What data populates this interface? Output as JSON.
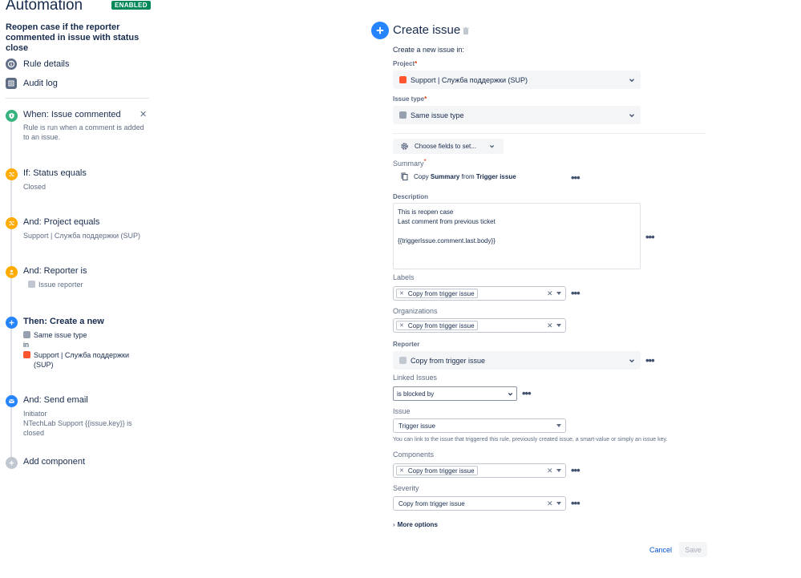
{
  "header": {
    "title": "Automation",
    "badge": "ENABLED"
  },
  "rule": {
    "name": "Reopen case if the reporter commented in issue with status close"
  },
  "nav": [
    {
      "label": "Rule details",
      "icon": "info-icon"
    },
    {
      "label": "Audit log",
      "icon": "log-icon"
    }
  ],
  "steps": {
    "trigger": {
      "title": "When: Issue commented",
      "sub": "Rule is run when a comment is added to an issue.",
      "color": "#36b37e"
    },
    "cond1": {
      "title": "If: Status equals",
      "sub": "Closed",
      "color": "#ffab00"
    },
    "cond2": {
      "title": "And: Project equals",
      "sub": "Support | Служба поддержки (SUP)",
      "color": "#ffab00"
    },
    "cond3": {
      "title": "And: Reporter is",
      "sub": "Issue reporter",
      "color": "#ffab00"
    },
    "action1": {
      "title": "Then: Create a new",
      "type": "Same issue type",
      "in": "in",
      "project": "Support | Служба поддержки (SUP)",
      "color": "#2684ff"
    },
    "action2": {
      "title": "And: Send email",
      "line1": "Initiator",
      "line2": "NTechLab Support {{issue.key}} is closed",
      "color": "#2684ff"
    },
    "add": {
      "title": "Add component"
    }
  },
  "editor": {
    "title": "Create issue",
    "intro": "Create a new issue in:",
    "project_label": "Project",
    "project_value": "Support | Служба поддержки (SUP)",
    "issue_type_label": "Issue type",
    "issue_type_value": "Same issue type",
    "choose_fields": "Choose fields to set...",
    "summary_label": "Summary",
    "summary_copy": "Copy",
    "summary_field": "Summary",
    "summary_from": "from",
    "summary_source": "Trigger issue",
    "description_label": "Description",
    "description_value": "This is reopen case\nLast comment from previous ticket\n\n{{triggerIssue.comment.last.body}}",
    "labels_label": "Labels",
    "labels_tag": "Copy from trigger issue",
    "organizations_label": "Organizations",
    "organizations_tag": "Copy from trigger issue",
    "reporter_label": "Reporter",
    "reporter_value": "Copy from trigger issue",
    "linked_label": "Linked Issues",
    "linked_value": "is blocked by",
    "issue_label": "Issue",
    "issue_value": "Trigger issue",
    "helper": "You can link to the issue that triggered this rule, previously created issue, a smart-value or simply an issue key.",
    "components_label": "Components",
    "components_tag": "Copy from trigger issue",
    "severity_label": "Severity",
    "severity_value": "Copy from trigger issue",
    "more_options": "More options",
    "cancel": "Cancel",
    "save": "Save"
  }
}
